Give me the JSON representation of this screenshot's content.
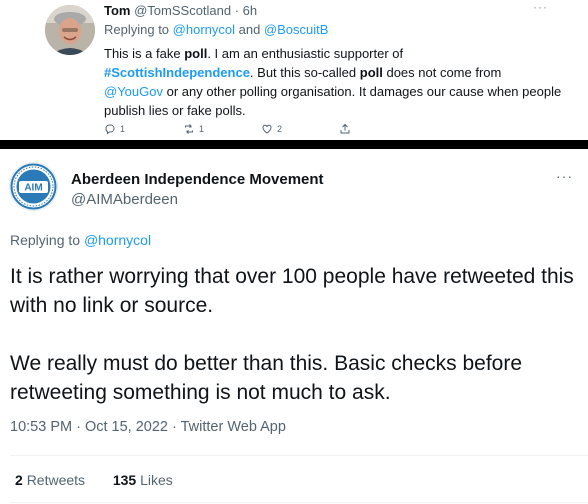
{
  "quoted_tweet": {
    "display_name": "Tom",
    "handle_time": "@TomSScotland · 6h",
    "more": "···",
    "replying_prefix": "Replying to ",
    "replying_to_1": "@hornycol",
    "replying_and": " and ",
    "replying_to_2": "@BoscuitB",
    "body": {
      "t1": "This is a fake ",
      "b1": "poll",
      "t2": ". I am an enthusiastic supporter of",
      "hashtag": "#ScottishIndependence",
      "t3": ". But this so-called ",
      "b2": "poll",
      "t4": " does not come from",
      "mention": "@YouGov",
      "t5": " or any other polling organisation. It damages our cause when people publish lies or fake polls."
    },
    "actions": {
      "replies": "1",
      "retweets": "1",
      "likes": "2"
    }
  },
  "main_tweet": {
    "display_name": "Aberdeen Independence Movement",
    "handle": "@AIMAberdeen",
    "avatar_text": "AIM",
    "more": "···",
    "replying_prefix": "Replying to ",
    "replying_to": "@hornycol",
    "paragraph_1": "It is rather worrying that over 100 people have retweeted this with no link or source.",
    "paragraph_2": "We really must do better than this. Basic checks before retweeting something is not much to ask.",
    "timestamp": "10:53 PM · Oct 15, 2022 · Twitter Web App",
    "retweets_count": "2",
    "retweets_label": "Retweets",
    "likes_count": "135",
    "likes_label": "Likes"
  },
  "colors": {
    "accent": "#1d9bf0",
    "secondary_text": "#536471",
    "divider": "#000000",
    "aim_blue": "#2a7ab8"
  }
}
